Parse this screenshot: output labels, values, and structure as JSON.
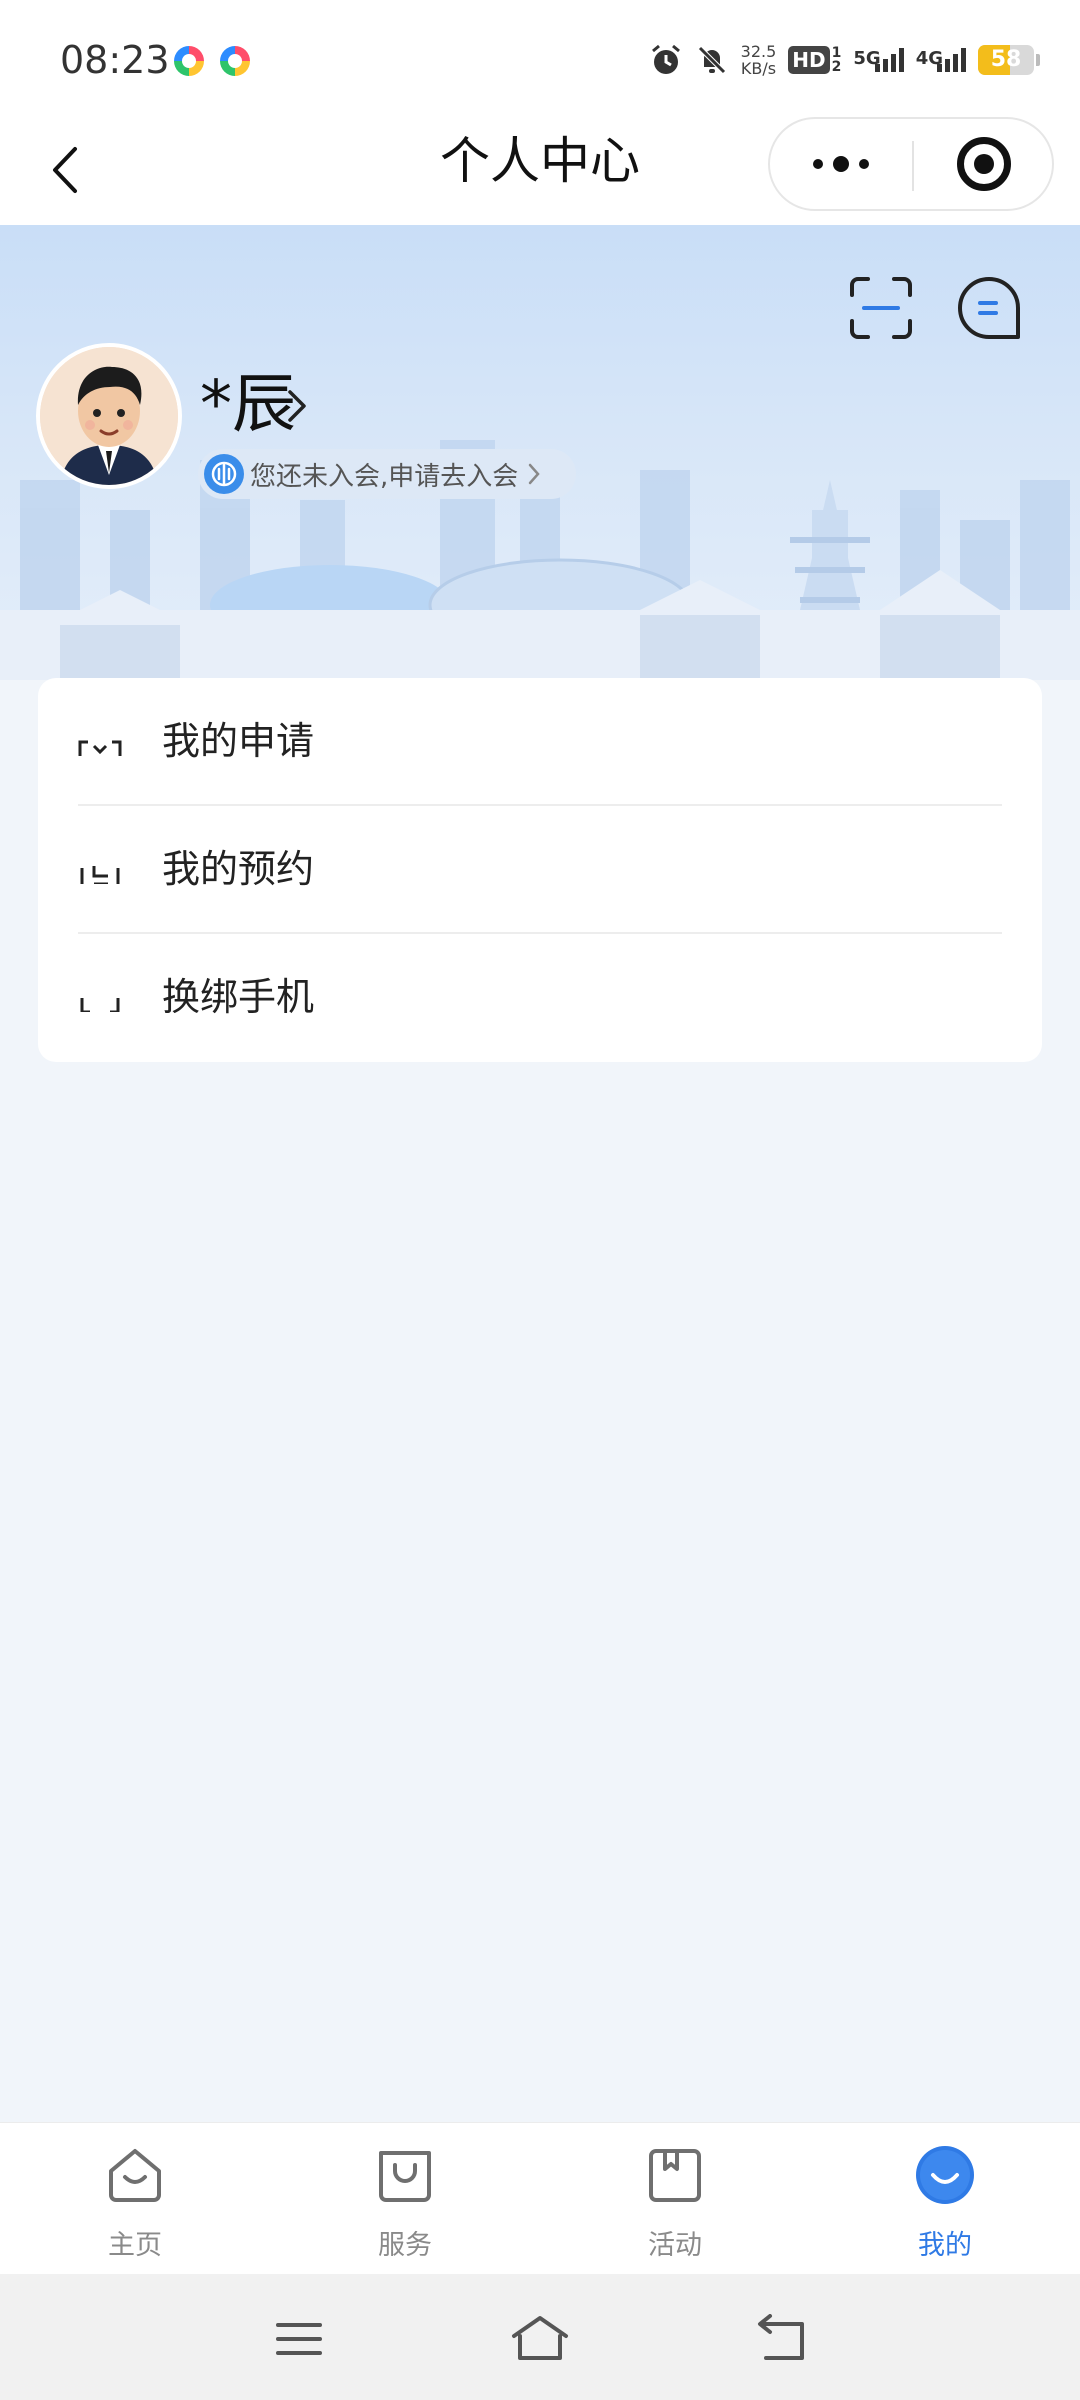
{
  "status_bar": {
    "time": "08:23",
    "net_speed_value": "32.5",
    "net_speed_unit": "KB/s",
    "hd_label": "HD",
    "hd_sub": "1",
    "hd_sub2": "2",
    "signal_1_label": "5G",
    "signal_2_label": "4G",
    "battery_level": "58",
    "battery_fraction": 0.58,
    "icons": [
      "alarm-icon",
      "mute-icon"
    ]
  },
  "nav_bar": {
    "title": "个人中心",
    "back_icon": "chevron-left-icon",
    "more_icon": "more-dots-icon",
    "close_icon": "target-circle-icon"
  },
  "profile": {
    "name": "*辰",
    "membership_text": "您还未入会,申请去入会",
    "header_icons": [
      "scan-icon",
      "message-bubble-icon"
    ]
  },
  "menu": {
    "items": [
      {
        "label": "我的申请",
        "icon": "application-icon"
      },
      {
        "label": "我的预约",
        "icon": "appointment-icon"
      },
      {
        "label": "换绑手机",
        "icon": "phone-icon"
      }
    ]
  },
  "tab_bar": {
    "items": [
      {
        "label": "主页",
        "icon": "home-icon",
        "active": false
      },
      {
        "label": "服务",
        "icon": "bag-icon",
        "active": false
      },
      {
        "label": "活动",
        "icon": "bookmark-icon",
        "active": false
      },
      {
        "label": "我的",
        "icon": "profile-icon",
        "active": true
      }
    ]
  },
  "colors": {
    "accent": "#2f7ae5",
    "battery": "#f3bd1b",
    "banner_top": "#c9def7",
    "page_bg": "#f1f5fa"
  },
  "system_nav": {
    "icons": [
      "menu-lines-icon",
      "home-outline-icon",
      "back-arrow-icon"
    ]
  }
}
